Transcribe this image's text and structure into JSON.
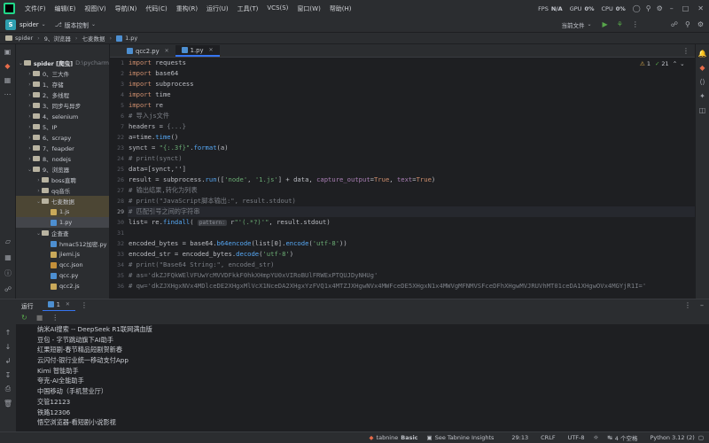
{
  "menubar": {
    "items": [
      "文件(F)",
      "编辑(E)",
      "视图(V)",
      "导航(N)",
      "代码(C)",
      "重构(R)",
      "运行(U)",
      "工具(T)",
      "VCS(S)",
      "窗口(W)",
      "帮助(H)"
    ],
    "fps_label": "FPS",
    "fps_value": "N/A",
    "gpu_label": "GPU",
    "gpu_value": "0%",
    "cpu_label": "CPU",
    "cpu_value": "0%"
  },
  "projbar": {
    "project_badge": "S",
    "project_name": "spider",
    "vcs_label": "版本控制",
    "run_config": "当前文件"
  },
  "breadcrumb": [
    "spider",
    "9、浏览器",
    "七麦数据",
    "1.py"
  ],
  "tree": {
    "root_label": "spider [爬虫]",
    "root_path": "D:\\pycharm",
    "items": [
      {
        "label": "0、三大件",
        "indent": 1,
        "kind": "folder",
        "open": false
      },
      {
        "label": "1、存储",
        "indent": 1,
        "kind": "folder",
        "open": false
      },
      {
        "label": "2、多线程",
        "indent": 1,
        "kind": "folder",
        "open": false
      },
      {
        "label": "3、同步与异步",
        "indent": 1,
        "kind": "folder",
        "open": false
      },
      {
        "label": "4、selenium",
        "indent": 1,
        "kind": "folder",
        "open": false
      },
      {
        "label": "5、IP",
        "indent": 1,
        "kind": "folder",
        "open": false
      },
      {
        "label": "6、scrapy",
        "indent": 1,
        "kind": "folder",
        "open": false
      },
      {
        "label": "7、feapder",
        "indent": 1,
        "kind": "folder",
        "open": false
      },
      {
        "label": "8、nodejs",
        "indent": 1,
        "kind": "folder",
        "open": false
      },
      {
        "label": "9、浏览器",
        "indent": 1,
        "kind": "folder",
        "open": true
      },
      {
        "label": "boss直聘",
        "indent": 2,
        "kind": "folder",
        "open": false
      },
      {
        "label": "qq音乐",
        "indent": 2,
        "kind": "folder",
        "open": false
      },
      {
        "label": "七麦数据",
        "indent": 2,
        "kind": "folder",
        "open": true,
        "state": "hl"
      },
      {
        "label": "1.js",
        "indent": 3,
        "kind": "js",
        "state": "hl"
      },
      {
        "label": "1.py",
        "indent": 3,
        "kind": "py",
        "state": "sel"
      },
      {
        "label": "企查查",
        "indent": 2,
        "kind": "folder",
        "open": true
      },
      {
        "label": "hmac512加密.py",
        "indent": 3,
        "kind": "py"
      },
      {
        "label": "jiemi.js",
        "indent": 3,
        "kind": "js"
      },
      {
        "label": "qcc.json",
        "indent": 3,
        "kind": "json"
      },
      {
        "label": "qcc.py",
        "indent": 3,
        "kind": "py"
      },
      {
        "label": "qcc2.js",
        "indent": 3,
        "kind": "js"
      }
    ]
  },
  "editor": {
    "tabs": [
      {
        "label": "qcc2.py",
        "active": false
      },
      {
        "label": "1.py",
        "active": true
      }
    ],
    "warnings": "1",
    "checks": "21",
    "current_line": 29,
    "lines": [
      {
        "n": 1,
        "t": [
          [
            "kw",
            "import "
          ],
          [
            "df",
            "requests"
          ]
        ]
      },
      {
        "n": 2,
        "t": [
          [
            "kw",
            "import "
          ],
          [
            "df",
            "base64"
          ]
        ]
      },
      {
        "n": 3,
        "t": [
          [
            "kw",
            "import "
          ],
          [
            "df",
            "subprocess"
          ]
        ]
      },
      {
        "n": 4,
        "t": [
          [
            "kw",
            "import "
          ],
          [
            "df",
            "time"
          ]
        ]
      },
      {
        "n": 5,
        "t": [
          [
            "kw",
            "import "
          ],
          [
            "df",
            "re"
          ]
        ]
      },
      {
        "n": 6,
        "t": [
          [
            "cm",
            "# 导入js文件"
          ]
        ]
      },
      {
        "n": 7,
        "t": [
          [
            "df",
            "headers = "
          ],
          [
            "cm",
            "{...}"
          ]
        ]
      },
      {
        "n": 22,
        "t": [
          [
            "df",
            "a=time."
          ],
          [
            "fn",
            "time"
          ],
          [
            "df",
            "()"
          ]
        ]
      },
      {
        "n": 23,
        "t": [
          [
            "df",
            "synct = "
          ],
          [
            "str",
            "\"{:.3f}\""
          ],
          [
            "df",
            "."
          ],
          [
            "fn",
            "format"
          ],
          [
            "df",
            "(a)"
          ]
        ]
      },
      {
        "n": 24,
        "t": [
          [
            "cm",
            "# print(synct)"
          ]
        ]
      },
      {
        "n": 25,
        "t": [
          [
            "df",
            "data=[synct,'']"
          ]
        ]
      },
      {
        "n": 26,
        "t": [
          [
            "df",
            "result = subprocess."
          ],
          [
            "fn",
            "run"
          ],
          [
            "df",
            "(["
          ],
          [
            "str",
            "'node'"
          ],
          [
            "df",
            ", "
          ],
          [
            "str",
            "'1.js'"
          ],
          [
            "df",
            "] + data, "
          ],
          [
            "pm",
            "capture_output"
          ],
          [
            "df",
            "="
          ],
          [
            "kw",
            "True"
          ],
          [
            "df",
            ", "
          ],
          [
            "pm",
            "text"
          ],
          [
            "df",
            "="
          ],
          [
            "kw",
            "True"
          ],
          [
            "df",
            ")"
          ]
        ]
      },
      {
        "n": 27,
        "t": [
          [
            "cm",
            "# 输出结果,转化为列表"
          ]
        ]
      },
      {
        "n": 28,
        "t": [
          [
            "cm",
            "# print(\"JavaScript脚本输出:\", result.stdout)"
          ]
        ]
      },
      {
        "n": 29,
        "t": [
          [
            "cm",
            "# 匹配引号之间的字符串"
          ]
        ]
      },
      {
        "n": 30,
        "t": [
          [
            "df",
            "list= re."
          ],
          [
            "fn",
            "findall"
          ],
          [
            "df",
            "( "
          ],
          [
            "hint",
            "pattern:"
          ],
          [
            "df",
            " r"
          ],
          [
            "str",
            "\"'(.*?)'\""
          ],
          [
            "df",
            ", result.stdout)"
          ]
        ]
      },
      {
        "n": 31,
        "t": []
      },
      {
        "n": 32,
        "t": [
          [
            "df",
            "encoded_bytes = base64."
          ],
          [
            "fn",
            "b64encode"
          ],
          [
            "df",
            "(list[0]."
          ],
          [
            "fn",
            "encode"
          ],
          [
            "df",
            "("
          ],
          [
            "str",
            "'utf-8'"
          ],
          [
            "df",
            "))"
          ]
        ]
      },
      {
        "n": 33,
        "t": [
          [
            "df",
            "encoded_str = encoded_bytes."
          ],
          [
            "fn",
            "decode"
          ],
          [
            "df",
            "("
          ],
          [
            "str",
            "'utf-8'"
          ],
          [
            "df",
            ")"
          ]
        ]
      },
      {
        "n": 34,
        "t": [
          [
            "cm",
            "# print(\"Base64 String:\", encoded_str)"
          ]
        ]
      },
      {
        "n": 35,
        "t": [
          [
            "cm",
            "# as='dkZJFQkWElVFUwYcMVVDFkkF0hkXHmpYU0xVIRoBUlFRWExPTQUJDyNHUg'"
          ]
        ]
      },
      {
        "n": 36,
        "t": [
          [
            "cm",
            "# qw='dkZJXHgxNVx4MDlceDE2XHgxMlVcX1NceDA2XHgxYzFVQ1x4MTZJXHgwNVx4MWFceDE5XHgxN1x4MWVgMFNMVSFceDFhXHgwMVJRUVhMT01ceDA1XHgwOVx4MGYjR1I='"
          ]
        ]
      }
    ]
  },
  "run": {
    "title": "运行",
    "tab_label": "1",
    "output": [
      "纳米AI搜索 -- DeepSeek R1联网满血版",
      "豆包 - 字节跳动旗下AI助手",
      "红果短剧-春节精品短剧贺新春",
      "云闪付-银行业统一移动支付App",
      "Kimi 智能助手",
      "夸克-AI全能助手",
      "中国移动（手机营业厅）",
      "交管12123",
      "铁路12306",
      "悟空浏览器-看短剧小说影视"
    ]
  },
  "status": {
    "tabnine": "tabnine",
    "tabnine_tier": "Basic",
    "tabnine_insights": "See Tabnine Insights",
    "position": "29:13",
    "line_sep": "CRLF",
    "encoding": "UTF-8",
    "indent": "4 个空格",
    "python": "Python 3.12 (2)"
  },
  "colors": {
    "accent": "#3574f0",
    "bg": "#1e1f22",
    "panel": "#2b2d30"
  }
}
